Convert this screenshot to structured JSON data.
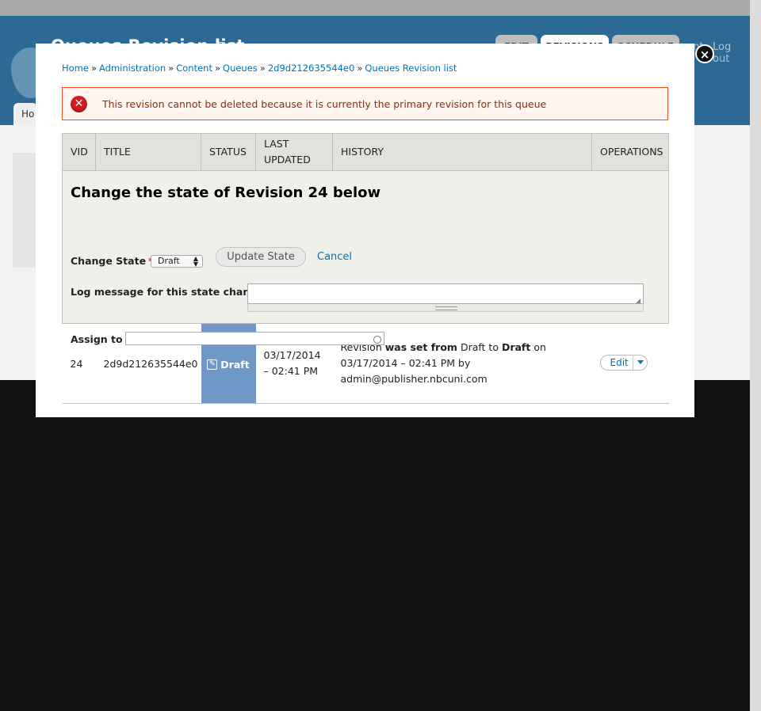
{
  "page": {
    "title": "Queues Revision list",
    "tabs": [
      {
        "label": "EDIT",
        "active": false
      },
      {
        "label": "REVISIONS",
        "active": true
      },
      {
        "label": "SCHEDULE",
        "active": false
      }
    ],
    "user_links": [
      "ount",
      "Log out"
    ],
    "nav_home_partial": "Ho"
  },
  "modal": {
    "close_icon": "close-x-icon",
    "breadcrumb": [
      "Home",
      "Administration",
      "Content",
      "Queues",
      "2d9d212635544e0",
      "Queues Revision list"
    ],
    "breadcrumb_separator": "»",
    "error": {
      "icon": "error-x-icon",
      "message": "This revision cannot be deleted because it is currently the primary revision for this queue",
      "border_color": "#ed541d",
      "background": "#fef5f1"
    },
    "table": {
      "headers": [
        "VID",
        "TITLE",
        "STATUS",
        "LAST UPDATED",
        "HISTORY",
        "OPERATIONS"
      ],
      "state_form": {
        "heading": "Change the state of Revision 24 below",
        "change_state_label": "Change State",
        "required_marker": "*",
        "selected_state": "Draft",
        "update_button": "Update State",
        "cancel_link": "Cancel",
        "log_label": "Log message for this state change",
        "log_value": "",
        "assign_label": "Assign to",
        "assign_value": ""
      },
      "rows": [
        {
          "vid": "24",
          "title": "2d9d212635544e0",
          "status": "Draft",
          "status_color": "#6f98c8",
          "updated": "03/17/2014 – 02:41 PM",
          "history": {
            "t1": "Revision ",
            "b1": "was set from",
            "t2": " Draft to ",
            "b2": "Draft",
            "t3": " on 03/17/2014 – 02:41 PM by admin@publisher.nbcuni.com"
          },
          "operation": "Edit"
        }
      ]
    }
  },
  "colors": {
    "header_blue": "#2c6a95",
    "link_blue": "#0072b9",
    "overlay": "#111111"
  }
}
